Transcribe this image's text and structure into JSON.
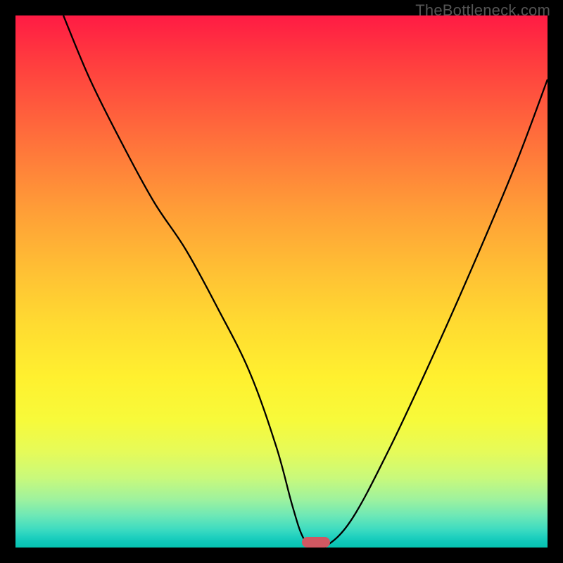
{
  "watermark": "TheBottleneck.com",
  "chart_data": {
    "type": "line",
    "title": "",
    "xlabel": "",
    "ylabel": "",
    "xlim": [
      0,
      100
    ],
    "ylim": [
      0,
      100
    ],
    "series": [
      {
        "name": "bottleneck-curve",
        "x": [
          9,
          14,
          20,
          26,
          32,
          38,
          44,
          49,
          52,
          54,
          56,
          58,
          63,
          70,
          78,
          86,
          94,
          100
        ],
        "y": [
          100,
          88,
          76,
          65,
          56,
          45,
          33,
          19,
          8,
          2,
          0,
          0,
          5,
          18,
          35,
          53,
          72,
          88
        ]
      }
    ],
    "marker": {
      "x": 56.5,
      "y": 0,
      "color": "#cf5862"
    },
    "background_gradient_meaning": "red=high bottleneck, green=optimal"
  }
}
